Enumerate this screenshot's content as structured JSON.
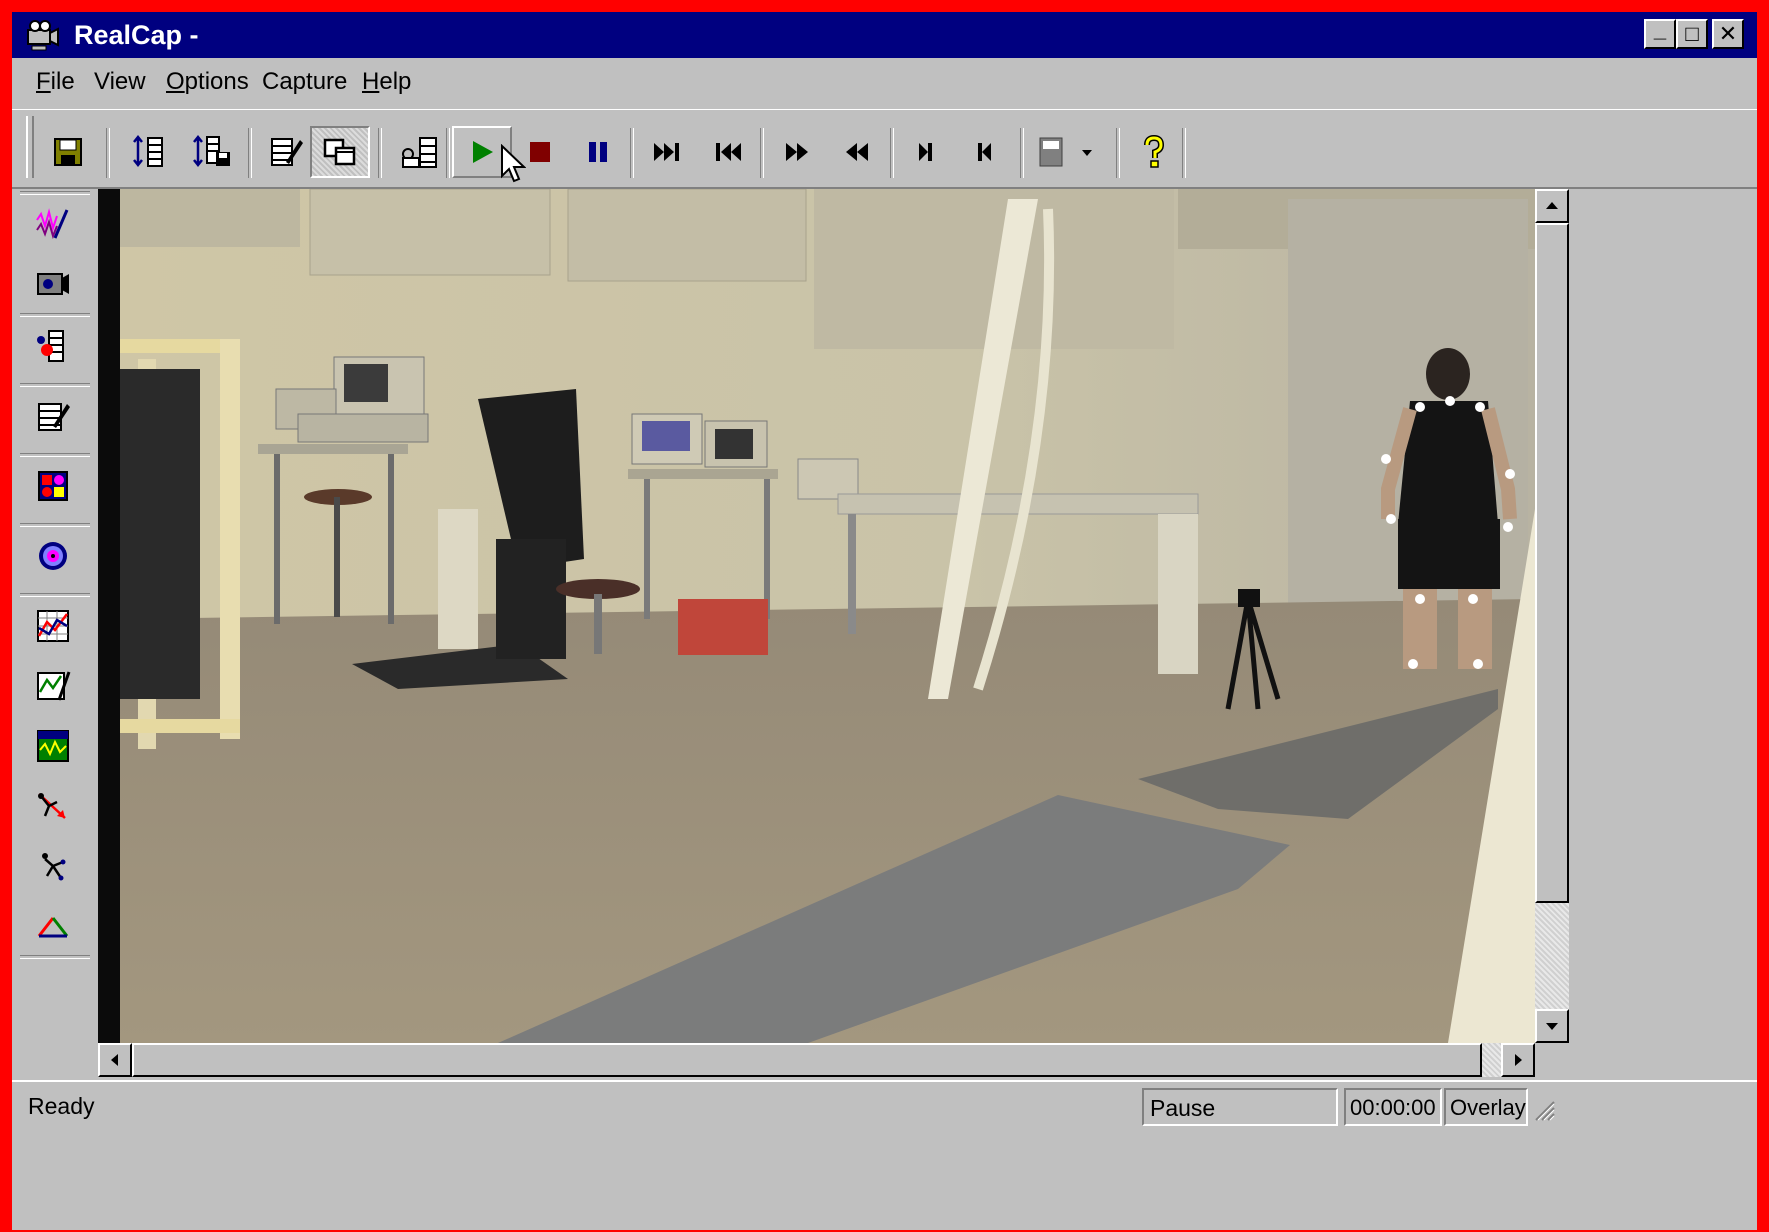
{
  "window": {
    "title": "RealCap -",
    "controls": {
      "minimize": "_",
      "maximize": "□",
      "close": "✕"
    }
  },
  "menubar": {
    "items": [
      {
        "label": "File",
        "mnemonic": "F",
        "rest": "ile"
      },
      {
        "label": "View",
        "mnemonic": "",
        "rest": "View"
      },
      {
        "label": "Options",
        "mnemonic": "O",
        "rest": "ptions"
      },
      {
        "label": "Capture",
        "mnemonic": "",
        "rest": "Capture"
      },
      {
        "label": "Help",
        "mnemonic": "H",
        "rest": "elp"
      }
    ]
  },
  "toolbar": {
    "buttons": [
      {
        "icon": "save-icon"
      },
      {
        "icon": "insert-frames-icon"
      },
      {
        "icon": "insert-file-icon"
      },
      {
        "icon": "edit-clip-icon"
      },
      {
        "icon": "window-toggle-icon",
        "state": "pressed"
      },
      {
        "icon": "camera-film-icon"
      },
      {
        "icon": "play-icon",
        "color": "#008000"
      },
      {
        "icon": "stop-icon",
        "color": "#800000"
      },
      {
        "icon": "pause-icon",
        "color": "#000080"
      },
      {
        "icon": "skip-to-end-icon"
      },
      {
        "icon": "skip-to-start-icon"
      },
      {
        "icon": "fast-forward-icon"
      },
      {
        "icon": "rewind-icon"
      },
      {
        "icon": "step-forward-icon"
      },
      {
        "icon": "step-back-icon"
      },
      {
        "icon": "display-dropdown-icon"
      },
      {
        "icon": "help-icon"
      }
    ]
  },
  "left_tools": [
    "waveform-icon",
    "video-camera-icon",
    "film-marker-icon",
    "edit-sheet-icon",
    "color-grid-icon",
    "target-icon",
    "graph-icon",
    "chart-tools-icon",
    "signal-panel-icon",
    "skeleton-arrow-icon",
    "stick-figure-icon",
    "triangle-icon"
  ],
  "status": {
    "message": "Ready",
    "mode": "Pause",
    "time": "00:00:00",
    "overlay": "Overlay"
  }
}
